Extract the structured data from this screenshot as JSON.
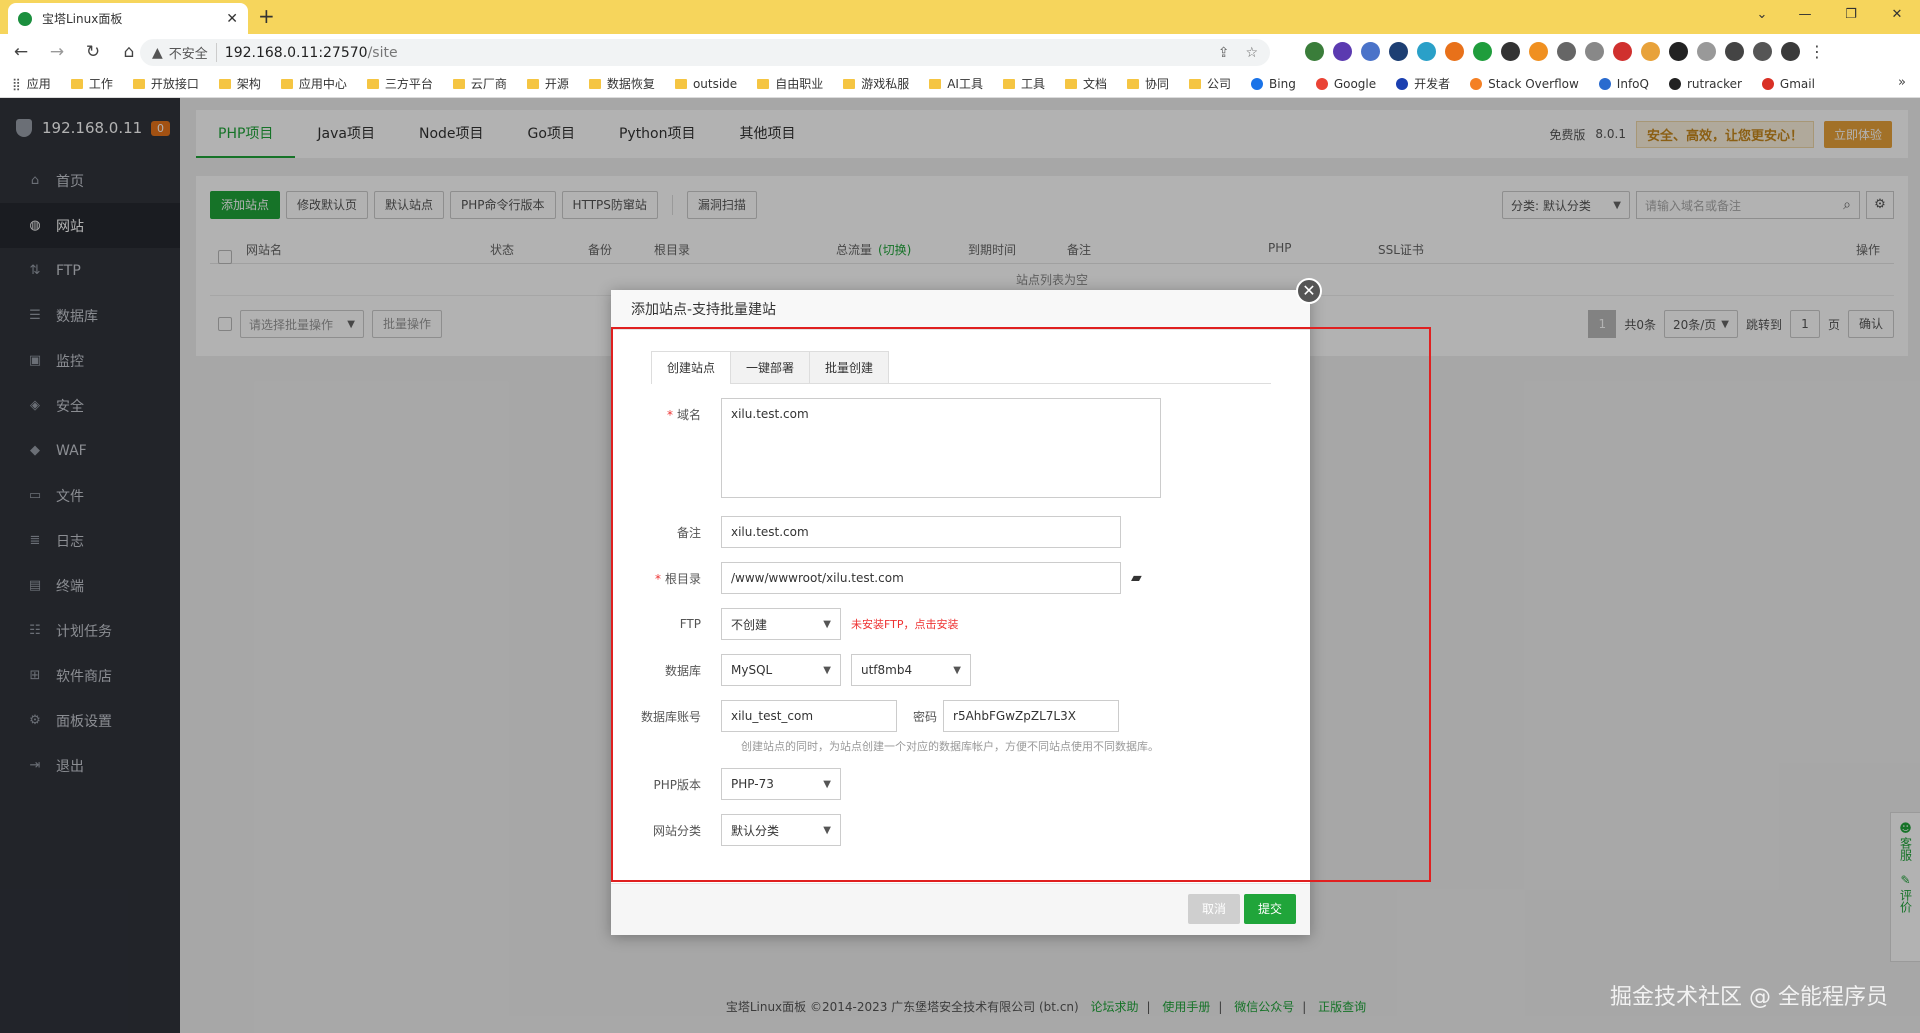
{
  "browser": {
    "tab_title": "宝塔Linux面板",
    "insecure_label": "不安全",
    "url_host": "192.168.0.11:27570",
    "url_path": "/site",
    "bookmarks": [
      "应用",
      "工作",
      "开放接口",
      "架构",
      "应用中心",
      "三方平台",
      "云厂商",
      "开源",
      "数据恢复",
      "outside",
      "自由职业",
      "游戏私服",
      "AI工具",
      "工具",
      "文档",
      "协同",
      "公司",
      "Bing",
      "Google",
      "开发者",
      "Stack Overflow",
      "InfoQ",
      "rutracker",
      "Gmail"
    ]
  },
  "sidebar": {
    "host": "192.168.0.11",
    "badge": "0",
    "items": [
      {
        "label": "首页",
        "icon": "home-icon"
      },
      {
        "label": "网站",
        "icon": "globe-icon"
      },
      {
        "label": "FTP",
        "icon": "ftp-icon"
      },
      {
        "label": "数据库",
        "icon": "database-icon"
      },
      {
        "label": "监控",
        "icon": "monitor-icon"
      },
      {
        "label": "安全",
        "icon": "shield-icon"
      },
      {
        "label": "WAF",
        "icon": "waf-shield-icon"
      },
      {
        "label": "文件",
        "icon": "folder-icon"
      },
      {
        "label": "日志",
        "icon": "log-icon"
      },
      {
        "label": "终端",
        "icon": "terminal-icon"
      },
      {
        "label": "计划任务",
        "icon": "schedule-icon"
      },
      {
        "label": "软件商店",
        "icon": "apps-icon"
      },
      {
        "label": "面板设置",
        "icon": "settings-icon"
      },
      {
        "label": "退出",
        "icon": "logout-icon"
      }
    ]
  },
  "topnav": {
    "tabs": [
      "PHP项目",
      "Java项目",
      "Node项目",
      "Go项目",
      "Python项目",
      "其他项目"
    ],
    "edition": "免费版",
    "version": "8.0.1",
    "banner": "安全、高效，让您更安心！",
    "upgrade": "立即体验"
  },
  "actions": {
    "add_site": "添加站点",
    "edit_default_page": "修改默认页",
    "default_site": "默认站点",
    "php_cli": "PHP命令行版本",
    "https_anti": "HTTPS防窜站",
    "vuln_scan": "漏洞扫描",
    "category": "分类: 默认分类",
    "search_placeholder": "请输入域名或备注"
  },
  "table": {
    "headers": [
      "网站名",
      "状态",
      "备份",
      "根目录",
      "总流量",
      "(切换)",
      "到期时间",
      "备注",
      "PHP",
      "SSL证书",
      "操作"
    ],
    "empty": "站点列表为空",
    "batch_select": "请选择批量操作",
    "batch_btn": "批量操作",
    "page": "1",
    "total": "共0条",
    "per_page": "20条/页",
    "jump_to": "跳转到",
    "jump_page": "1",
    "page_unit": "页",
    "confirm": "确认"
  },
  "modal": {
    "title": "添加站点-支持批量建站",
    "tabs": [
      "创建站点",
      "一键部署",
      "批量创建"
    ],
    "domain_label": "域名",
    "domain_value": "xilu.test.com",
    "remark_label": "备注",
    "remark_value": "xilu.test.com",
    "root_label": "根目录",
    "root_value": "/www/wwwroot/xilu.test.com",
    "ftp_label": "FTP",
    "ftp_value": "不创建",
    "ftp_warn": "未安装FTP，点击安装",
    "db_label": "数据库",
    "db_type": "MySQL",
    "db_charset": "utf8mb4",
    "db_account_label": "数据库账号",
    "db_account": "xilu_test_com",
    "pwd_label": "密码",
    "pwd_value": "r5AhbFGwZpZL7L3X",
    "db_hint": "创建站点的同时，为站点创建一个对应的数据库帐户，方便不同站点使用不同数据库。",
    "php_label": "PHP版本",
    "php_value": "PHP-73",
    "cat_label": "网站分类",
    "cat_value": "默认分类",
    "cancel": "取消",
    "submit": "提交"
  },
  "footer": {
    "copyright": "宝塔Linux面板 ©2014-2023 广东堡塔安全技术有限公司 (bt.cn)",
    "links": [
      "论坛求助",
      "使用手册",
      "微信公众号",
      "正版查询"
    ]
  },
  "watermark": "掘金技术社区 @ 全能程序员",
  "kefu": {
    "service": "客服",
    "review": "评价"
  }
}
